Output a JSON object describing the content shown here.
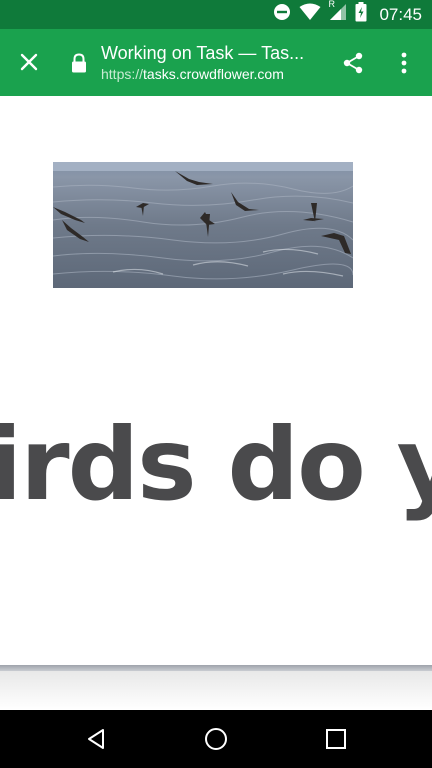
{
  "status_bar": {
    "time": "07:45",
    "icons": [
      "do-not-disturb-icon",
      "wifi-icon",
      "signal-icon",
      "battery-charging-icon"
    ],
    "signal_badge": "R"
  },
  "app_bar": {
    "close_icon": "close-icon",
    "lock_icon": "lock-icon",
    "title": "Working on Task — Tas...",
    "url_scheme": "https://",
    "url_host": "tasks.crowdflower.com",
    "share_icon": "share-icon",
    "menu_icon": "more-vert-icon",
    "color": "#1aa24e",
    "status_color": "#0f7a3a"
  },
  "content": {
    "image_subject": "birds flying over sea",
    "headline": "irds do yo"
  },
  "nav_bar": {
    "icons": [
      "back-icon",
      "home-icon",
      "recents-icon"
    ]
  }
}
